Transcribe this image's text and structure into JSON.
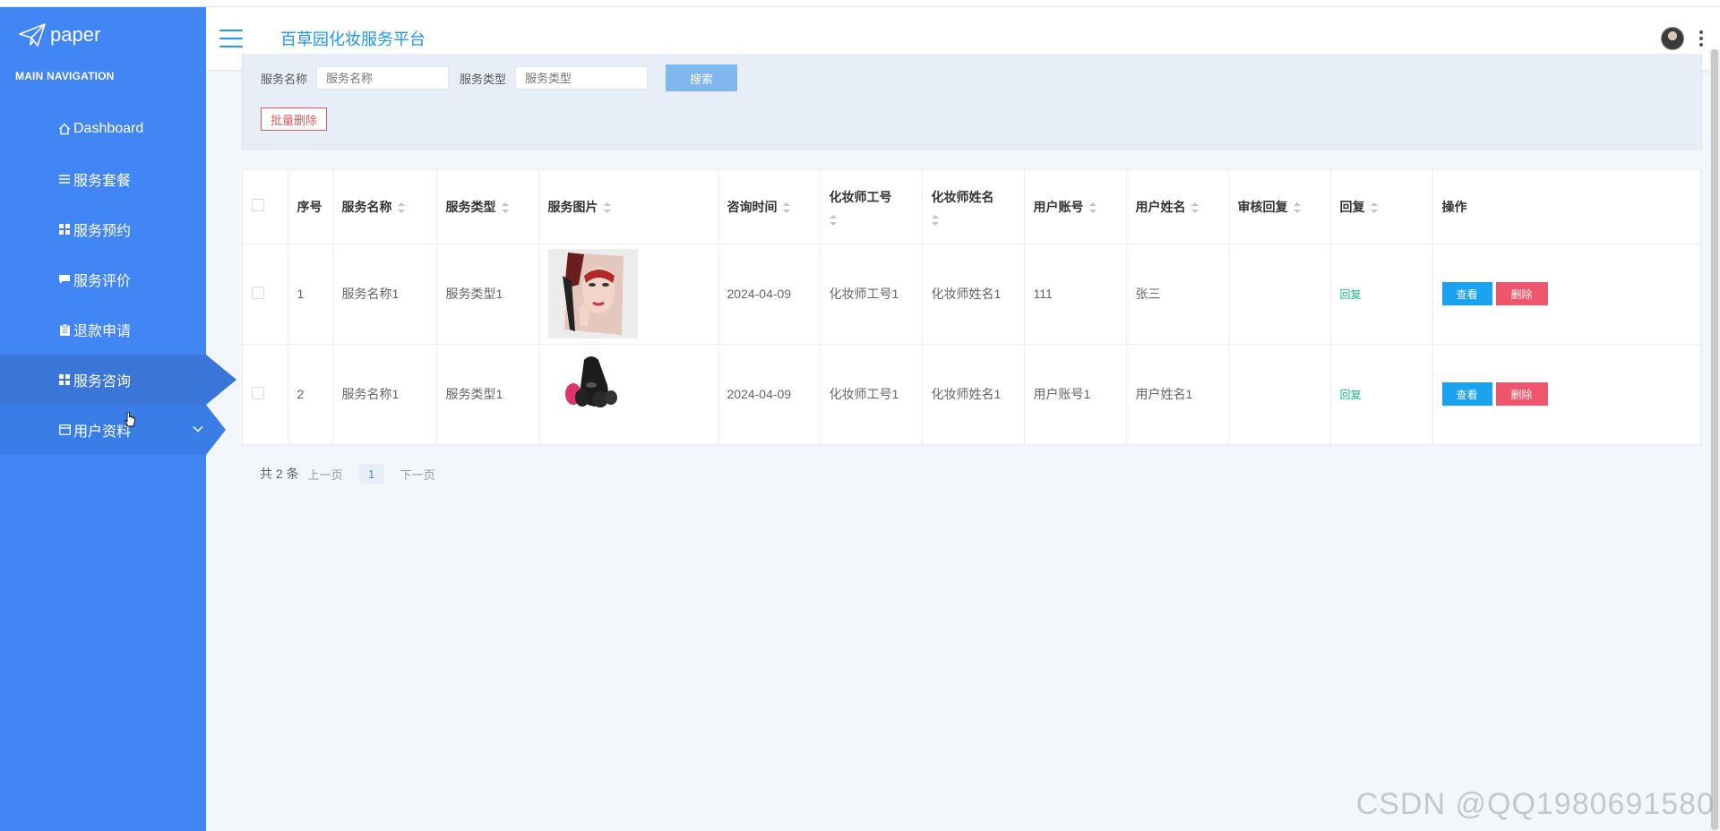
{
  "app": {
    "brand": "paper",
    "title": "百草园化妆服务平台"
  },
  "sidebar": {
    "heading": "MAIN NAVIGATION",
    "items": [
      {
        "label": "Dashboard",
        "icon": "home-icon"
      },
      {
        "label": "服务套餐",
        "icon": "list-icon"
      },
      {
        "label": "服务预约",
        "icon": "grid-icon"
      },
      {
        "label": "服务评价",
        "icon": "comment-icon"
      },
      {
        "label": "退款申请",
        "icon": "clipboard-icon"
      },
      {
        "label": "服务咨询",
        "icon": "grid-icon",
        "active": true
      },
      {
        "label": "用户资料",
        "icon": "card-icon",
        "expandable": true
      }
    ]
  },
  "search": {
    "name_label": "服务名称",
    "name_placeholder": "服务名称",
    "type_label": "服务类型",
    "type_placeholder": "服务类型",
    "button": "搜索",
    "batch_delete": "批量删除"
  },
  "table": {
    "columns": [
      "序号",
      "服务名称",
      "服务类型",
      "服务图片",
      "咨询时间",
      "化妆师工号",
      "化妆师姓名",
      "用户账号",
      "用户姓名",
      "审核回复",
      "回复",
      "操作"
    ],
    "rows": [
      {
        "no": "1",
        "service_name": "服务名称1",
        "service_type": "服务类型1",
        "time": "2024-04-09",
        "artist_id": "化妆师工号1",
        "artist_name": "化妆师姓名1",
        "user_account": "111",
        "user_name": "张三",
        "review_reply": "",
        "reply": "回复",
        "view": "查看",
        "delete": "删除"
      },
      {
        "no": "2",
        "service_name": "服务名称1",
        "service_type": "服务类型1",
        "time": "2024-04-09",
        "artist_id": "化妆师工号1",
        "artist_name": "化妆师姓名1",
        "user_account": "用户账号1",
        "user_name": "用户姓名1",
        "review_reply": "",
        "reply": "回复",
        "view": "查看",
        "delete": "删除"
      }
    ]
  },
  "pagination": {
    "total": "共 2 条",
    "prev": "上一页",
    "current": "1",
    "next": "下一页"
  },
  "watermark": "CSDN @QQ1980691580",
  "colors": {
    "sidebar": "#4286f5",
    "accent": "#2196f3",
    "view": "#1aa3f0",
    "delete": "#f0566b",
    "reply": "#13c08c"
  }
}
